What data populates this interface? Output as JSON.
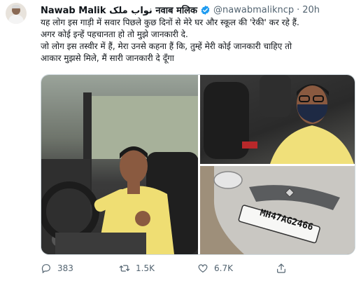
{
  "tweet": {
    "author_name": "Nawab Malik نواب ملک नवाब मलिक",
    "handle": "@nawabmalikncp",
    "separator": "·",
    "time": "20h",
    "text_lines": [
      "यह लोग इस गाड़ी में सवार पिछले कुछ दिनों से मेरे घर और स्कूल की 'रेकी' कर रहे हैं.",
      "अगर कोई इन्हें पहचानता हो तो मुझे जानकारी दे.",
      "जो लोग इस तस्वीर में हैं, मेरा उनसे कहना हैं कि, तुम्हें मेरी कोई जानकारी चाहिए तो",
      "आकार मुझसे मिले, मैं सारी जानकारी दे दूँगा"
    ],
    "license_plate": "MH47AG2466",
    "actions": {
      "replies": "383",
      "retweets": "1.5K",
      "likes": "6.7K"
    }
  },
  "colors": {
    "verified": "#1d9bf0",
    "muted": "#536471",
    "mask": "#1e2a44",
    "shirt": "#f0e07a"
  }
}
